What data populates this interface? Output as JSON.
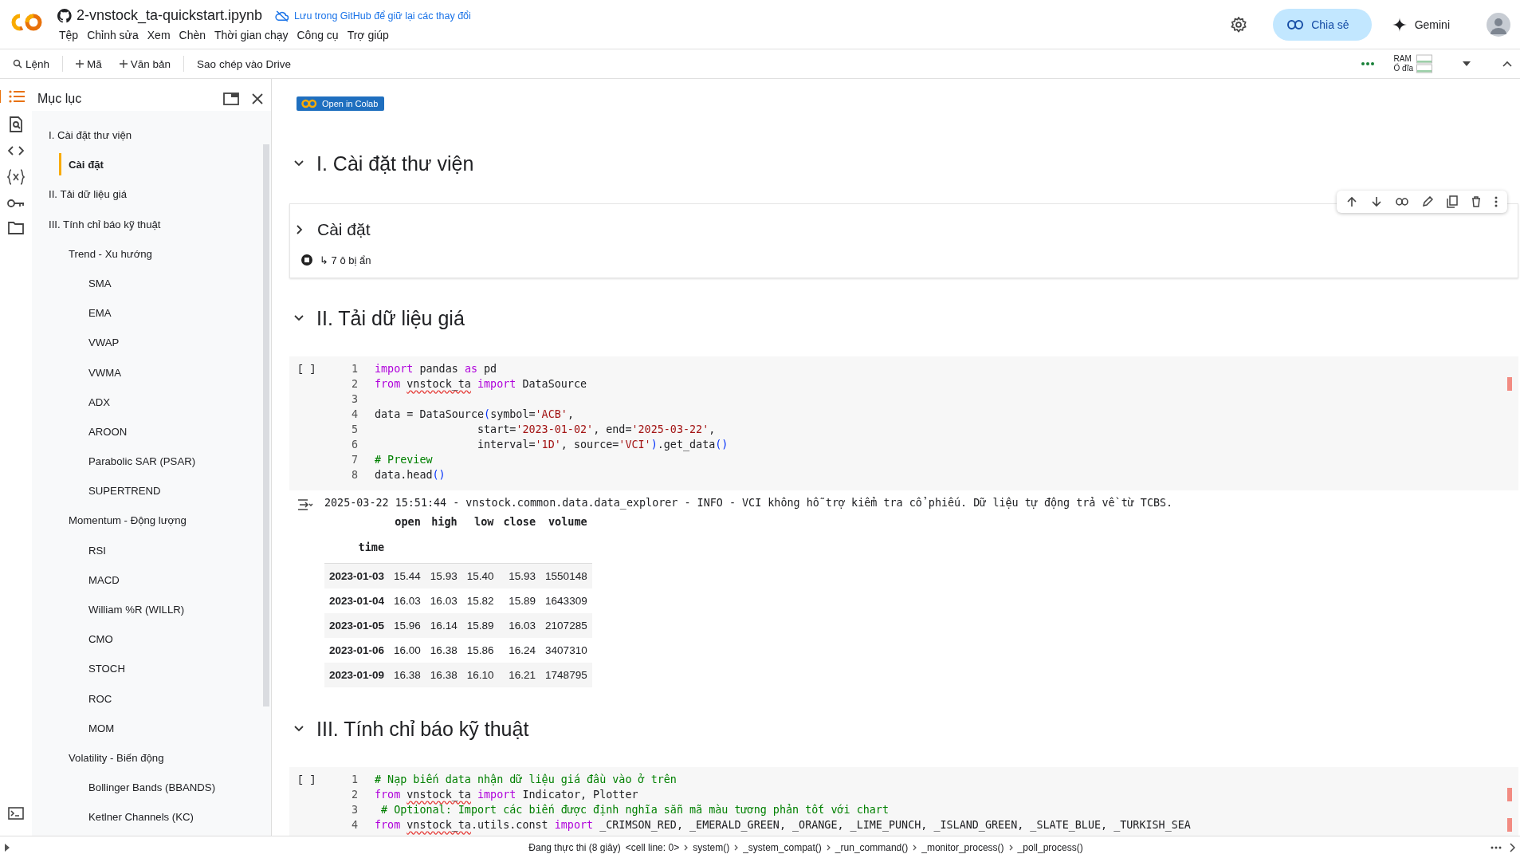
{
  "header": {
    "file_name": "2-vnstock_ta-quickstart.ipynb",
    "save_note": "Lưu trong GitHub để giữ lại các thay đổi",
    "share_label": "Chia sẻ",
    "gemini_label": "Gemini",
    "menu": [
      "Tệp",
      "Chỉnh sửa",
      "Xem",
      "Chèn",
      "Thời gian chạy",
      "Công cụ",
      "Trợ giúp"
    ]
  },
  "toolbar": {
    "command_label": "Lệnh",
    "add_code_label": "Mã",
    "add_text_label": "Văn bản",
    "copy_drive_label": "Sao chép vào Drive",
    "ram_label": "RAM",
    "disk_label": "Ổ đĩa"
  },
  "sidebar": {
    "title": "Mục lục",
    "items": [
      {
        "label": "I. Cài đặt thư viện",
        "selected": false,
        "children": [
          {
            "label": "Cài đặt",
            "selected": true
          }
        ]
      },
      {
        "label": "II. Tải dữ liệu giá",
        "selected": false
      },
      {
        "label": "III. Tính chỉ báo kỹ thuật",
        "selected": false,
        "children": [
          {
            "label": "Trend - Xu hướng",
            "selected": false,
            "children": [
              {
                "label": "SMA",
                "selected": false
              },
              {
                "label": "EMA",
                "selected": false
              },
              {
                "label": "VWAP",
                "selected": false
              },
              {
                "label": "VWMA",
                "selected": false
              },
              {
                "label": "ADX",
                "selected": false
              },
              {
                "label": "AROON",
                "selected": false
              },
              {
                "label": "Parabolic SAR (PSAR)",
                "selected": false
              },
              {
                "label": "SUPERTREND",
                "selected": false
              }
            ]
          },
          {
            "label": "Momentum - Động lượng",
            "selected": false,
            "children": [
              {
                "label": "RSI",
                "selected": false
              },
              {
                "label": "MACD",
                "selected": false
              },
              {
                "label": "William %R (WILLR)",
                "selected": false
              },
              {
                "label": "CMO",
                "selected": false
              },
              {
                "label": "STOCH",
                "selected": false
              },
              {
                "label": "ROC",
                "selected": false
              },
              {
                "label": "MOM",
                "selected": false
              }
            ]
          },
          {
            "label": "Volatility - Biến động",
            "selected": false,
            "children": [
              {
                "label": "Bollinger Bands (BBANDS)",
                "selected": false
              },
              {
                "label": "Ketlner Channels (KC)",
                "selected": false
              }
            ]
          }
        ]
      }
    ]
  },
  "badge": {
    "label": "Open in Colab"
  },
  "cells": [
    {
      "kind": "section",
      "title": "I. Cài đặt thư viện",
      "expanded": true
    },
    {
      "kind": "subsection",
      "title": "Cài đặt",
      "expanded": false,
      "hidden_note": "↳ 7 ô bị ẩn"
    },
    {
      "kind": "section",
      "title": "II. Tải dữ liệu giá",
      "expanded": true
    },
    {
      "kind": "code",
      "prompt": "[ ]",
      "lines": [
        {
          "number": "1",
          "flagged": false,
          "tokens": [
            {
              "kind": "keyword",
              "t": "import "
            },
            {
              "kind": "plain",
              "t": "pandas "
            },
            {
              "kind": "keyword",
              "t": "as "
            },
            {
              "kind": "plain",
              "t": "pd"
            }
          ]
        },
        {
          "number": "2",
          "flagged": true,
          "tokens": [
            {
              "kind": "keyword",
              "t": "from "
            },
            {
              "kind": "squiggle",
              "t": "vnstock_ta"
            },
            {
              "kind": "keyword",
              "t": " import "
            },
            {
              "kind": "plain",
              "t": "DataSource"
            }
          ]
        },
        {
          "number": "3",
          "flagged": false
        },
        {
          "number": "4",
          "flagged": false,
          "tokens": [
            {
              "kind": "plain",
              "t": "data = DataSource"
            },
            {
              "kind": "paren",
              "t": "("
            },
            {
              "kind": "plain",
              "t": "symbol="
            },
            {
              "kind": "string",
              "t": "'ACB'"
            },
            {
              "kind": "plain",
              "t": ","
            }
          ]
        },
        {
          "number": "5",
          "flagged": false,
          "tokens": [
            {
              "kind": "plain",
              "t": "                start="
            },
            {
              "kind": "string",
              "t": "'2023-01-02'"
            },
            {
              "kind": "plain",
              "t": ", end="
            },
            {
              "kind": "string",
              "t": "'2025-03-22'"
            },
            {
              "kind": "plain",
              "t": ","
            }
          ]
        },
        {
          "number": "6",
          "flagged": false,
          "tokens": [
            {
              "kind": "plain",
              "t": "                interval="
            },
            {
              "kind": "string",
              "t": "'1D'"
            },
            {
              "kind": "plain",
              "t": ", source="
            },
            {
              "kind": "string",
              "t": "'VCI'"
            },
            {
              "kind": "paren",
              "t": ")"
            },
            {
              "kind": "plain",
              "t": ".get_data"
            },
            {
              "kind": "paren",
              "t": "()"
            }
          ]
        },
        {
          "number": "7",
          "flagged": false,
          "tokens": [
            {
              "kind": "comment",
              "t": "# Preview"
            }
          ]
        },
        {
          "number": "8",
          "flagged": false,
          "tokens": [
            {
              "kind": "plain",
              "t": "data.head"
            },
            {
              "kind": "paren",
              "t": "()"
            }
          ]
        }
      ],
      "output": {
        "log": "2025-03-22 15:51:44 - vnstock.common.data.data_explorer - INFO - VCI không hỗ trợ kiểm tra cổ phiếu. Dữ liệu tự động trả về từ TCBS.",
        "columns": [
          "open",
          "high",
          "low",
          "close",
          "volume"
        ],
        "index_name": "time",
        "rows": [
          {
            "index": "2023-01-03",
            "values": [
              "15.44",
              "15.93",
              "15.40",
              "15.93",
              "1550148"
            ]
          },
          {
            "index": "2023-01-04",
            "values": [
              "16.03",
              "16.03",
              "15.82",
              "15.89",
              "1643309"
            ]
          },
          {
            "index": "2023-01-05",
            "values": [
              "15.96",
              "16.14",
              "15.89",
              "16.03",
              "2107285"
            ]
          },
          {
            "index": "2023-01-06",
            "values": [
              "16.00",
              "16.38",
              "15.86",
              "16.24",
              "3407310"
            ]
          },
          {
            "index": "2023-01-09",
            "values": [
              "16.38",
              "16.38",
              "16.10",
              "16.21",
              "1748795"
            ]
          }
        ]
      }
    },
    {
      "kind": "section",
      "title": "III. Tính chỉ báo kỹ thuật",
      "expanded": true
    },
    {
      "kind": "code",
      "prompt": "[ ]",
      "lines": [
        {
          "number": "1",
          "flagged": false,
          "tokens": [
            {
              "kind": "comment",
              "t": "# Nạp biến data nhận dữ liệu giá đầu vào ở trên"
            }
          ]
        },
        {
          "number": "2",
          "flagged": true,
          "tokens": [
            {
              "kind": "keyword",
              "t": "from "
            },
            {
              "kind": "squiggle",
              "t": "vnstock_ta"
            },
            {
              "kind": "keyword",
              "t": " import "
            },
            {
              "kind": "plain",
              "t": "Indicator, Plotter"
            }
          ]
        },
        {
          "number": "3",
          "flagged": false,
          "tokens": [
            {
              "kind": "comment",
              "t": " # Optional: Import các biến được định nghĩa sẵn mã màu tương phản tốt với chart"
            }
          ]
        },
        {
          "number": "4",
          "flagged": true,
          "tokens": [
            {
              "kind": "keyword",
              "t": "from "
            },
            {
              "kind": "squiggle",
              "t": "vnstock_ta"
            },
            {
              "kind": "plain",
              "t": ".utils.const "
            },
            {
              "kind": "keyword",
              "t": "import "
            },
            {
              "kind": "plain",
              "t": "_CRIMSON_RED, _EMERALD_GREEN, _ORANGE, _LIME_PUNCH, _ISLAND_GREEN, _SLATE_BLUE, _TURKISH_SEA"
            }
          ]
        }
      ]
    }
  ],
  "status_bar": {
    "label": "Đang thực thi (8 giây)",
    "trace": [
      "<cell line: 0>",
      "system()",
      "_system_compat()",
      "_run_command()",
      "_monitor_process()",
      "_poll_process()"
    ]
  }
}
